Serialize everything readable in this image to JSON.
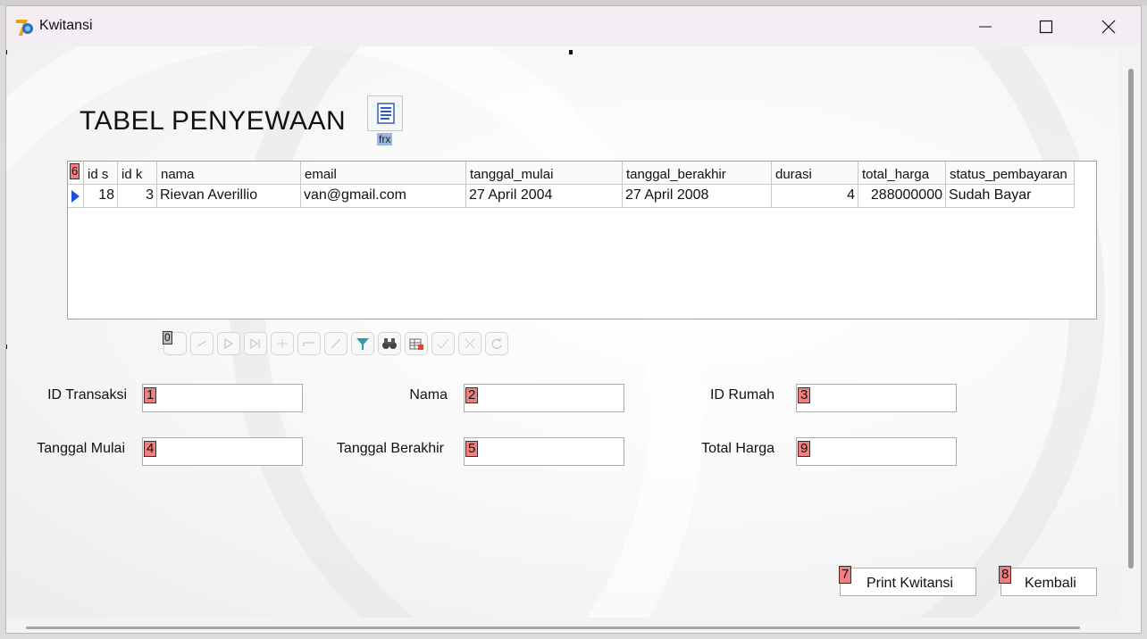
{
  "window": {
    "title": "Kwitansi"
  },
  "heading": "TABEL PENYEWAAN",
  "frx": {
    "label": "frx"
  },
  "grid": {
    "corner_tag": "6",
    "columns": [
      "id s",
      "id k",
      "nama",
      "email",
      "tanggal_mulai",
      "tanggal_berakhir",
      "durasi",
      "total_harga",
      "status_pembayaran"
    ],
    "rows": [
      [
        "18",
        "3",
        "Rievan Averillio",
        "van@gmail.com",
        "27 April 2004",
        "27 April 2008",
        "4",
        "288000000",
        "Sudah Bayar"
      ]
    ]
  },
  "navbar": {
    "tag": "0"
  },
  "form": {
    "id_transaksi": {
      "label": "ID Transaksi",
      "tag": "1"
    },
    "nama": {
      "label": "Nama",
      "tag": "2"
    },
    "id_rumah": {
      "label": "ID Rumah",
      "tag": "3"
    },
    "tanggal_mulai": {
      "label": "Tanggal Mulai",
      "tag": "4"
    },
    "tanggal_berakhir": {
      "label": "Tanggal Berakhir",
      "tag": "5"
    },
    "total_harga": {
      "label": "Total Harga",
      "tag": "9"
    }
  },
  "buttons": {
    "print": {
      "label": "Print Kwitansi",
      "tag": "7"
    },
    "kembali": {
      "label": "Kembali",
      "tag": "8"
    }
  }
}
